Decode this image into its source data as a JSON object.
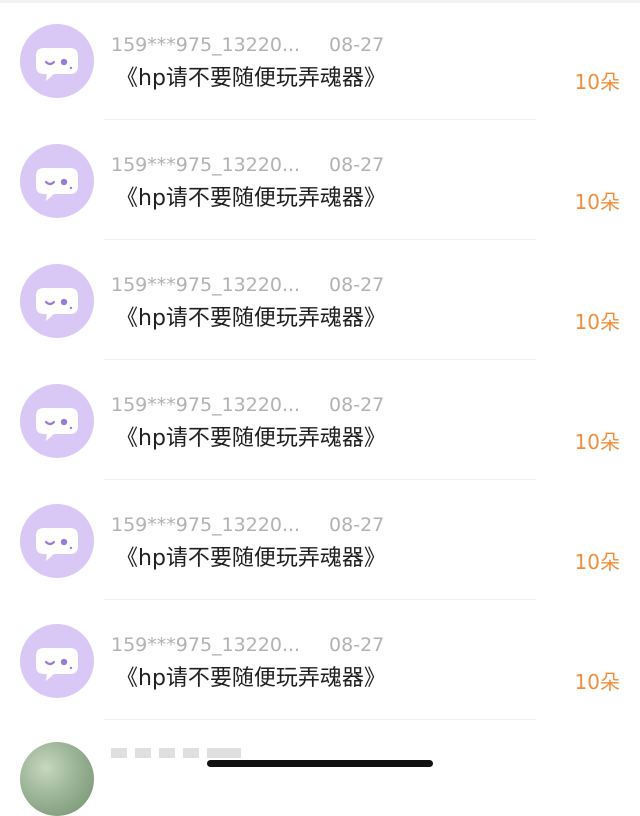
{
  "records": [
    {
      "user": "159***975_13220...",
      "date": "08-27",
      "title": "《hp请不要随便玩弄魂器》",
      "amount": "10朵"
    },
    {
      "user": "159***975_13220...",
      "date": "08-27",
      "title": "《hp请不要随便玩弄魂器》",
      "amount": "10朵"
    },
    {
      "user": "159***975_13220...",
      "date": "08-27",
      "title": "《hp请不要随便玩弄魂器》",
      "amount": "10朵"
    },
    {
      "user": "159***975_13220...",
      "date": "08-27",
      "title": "《hp请不要随便玩弄魂器》",
      "amount": "10朵"
    },
    {
      "user": "159***975_13220...",
      "date": "08-27",
      "title": "《hp请不要随便玩弄魂器》",
      "amount": "10朵"
    },
    {
      "user": "159***975_13220...",
      "date": "08-27",
      "title": "《hp请不要随便玩弄魂器》",
      "amount": "10朵"
    }
  ],
  "colors": {
    "avatar_bg": "#d9c8f5",
    "avatar_icon": "#ffffff",
    "avatar_icon_eye": "#9b79d8",
    "amount": "#f08e3b",
    "meta_text": "#b2b2b2",
    "title_text": "#1f1f1f"
  },
  "icons": {
    "avatar": "chat-bubble-face-icon",
    "partial_avatar": "photo-avatar-icon"
  }
}
